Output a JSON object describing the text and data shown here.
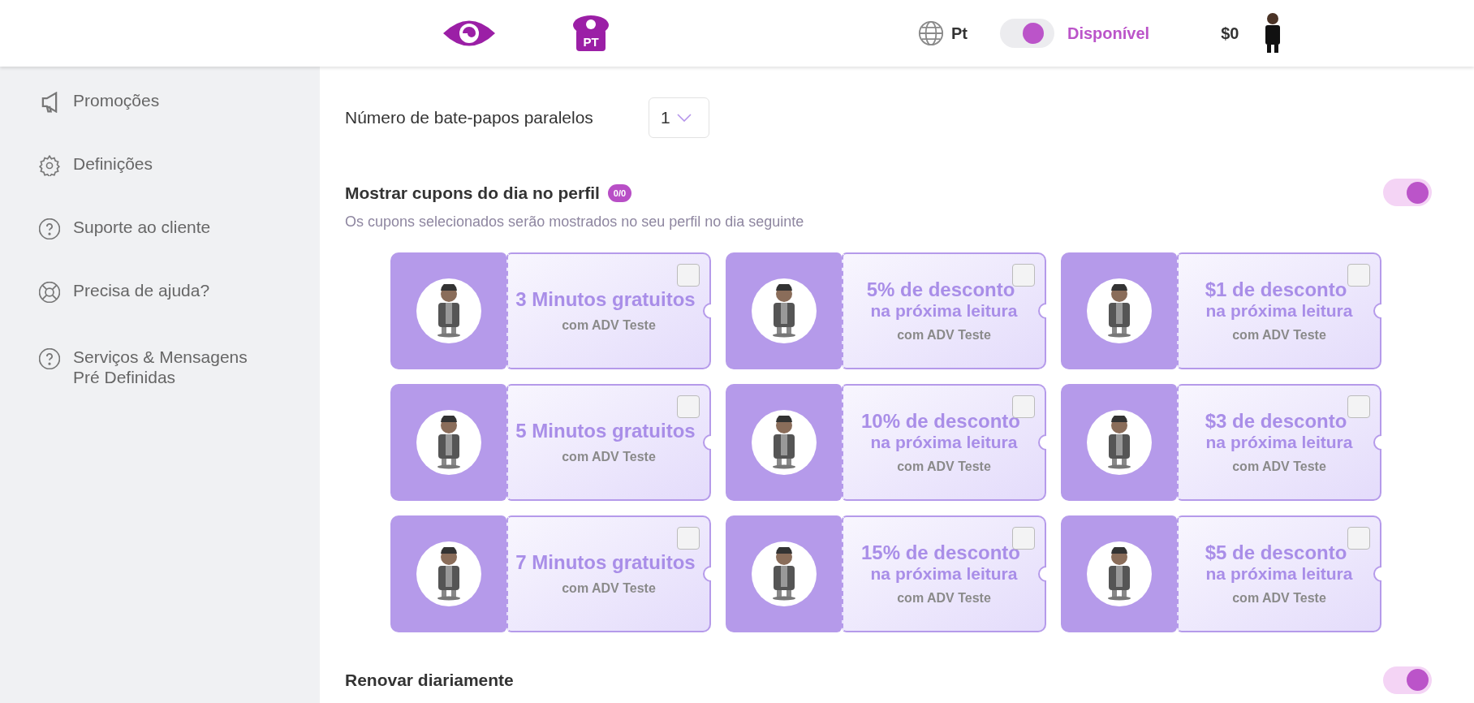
{
  "header": {
    "logo_badge": "PT",
    "language": "Pt",
    "availability": {
      "label": "Disponível",
      "on": true
    },
    "balance": "$0"
  },
  "sidebar": {
    "items": [
      {
        "label": "Promoções"
      },
      {
        "label": "Definições"
      },
      {
        "label": "Suporte ao cliente"
      },
      {
        "label": "Precisa de ajuda?"
      },
      {
        "label": "Serviços & Mensagens Pré Definidas"
      }
    ]
  },
  "parallel_chats": {
    "label": "Número de bate-papos paralelos",
    "value": "1"
  },
  "daily_coupons": {
    "title": "Mostrar cupons do dia no perfil",
    "badge": "0/0",
    "description": "Os cupons selecionados serão mostrados no seu perfil no dia seguinte",
    "on": true,
    "coupons": [
      {
        "title": "3 Minutos gratuitos",
        "owner": "com ADV Teste",
        "checked": false
      },
      {
        "title": "5% de desconto",
        "subtitle": "na próxima leitura",
        "owner": "com ADV Teste",
        "checked": false
      },
      {
        "title": "$1 de desconto",
        "subtitle": "na próxima leitura",
        "owner": "com ADV Teste",
        "checked": false
      },
      {
        "title": "5 Minutos gratuitos",
        "owner": "com ADV Teste",
        "checked": false
      },
      {
        "title": "10% de desconto",
        "subtitle": "na próxima leitura",
        "owner": "com ADV Teste",
        "checked": false
      },
      {
        "title": "$3 de desconto",
        "subtitle": "na próxima leitura",
        "owner": "com ADV Teste",
        "checked": false
      },
      {
        "title": "7 Minutos gratuitos",
        "owner": "com ADV Teste",
        "checked": false
      },
      {
        "title": "15% de desconto",
        "subtitle": "na próxima leitura",
        "owner": "com ADV Teste",
        "checked": false
      },
      {
        "title": "$5 de desconto",
        "subtitle": "na próxima leitura",
        "owner": "com ADV Teste",
        "checked": false
      }
    ]
  },
  "renew_daily": {
    "label": "Renovar diariamente",
    "on": true
  }
}
